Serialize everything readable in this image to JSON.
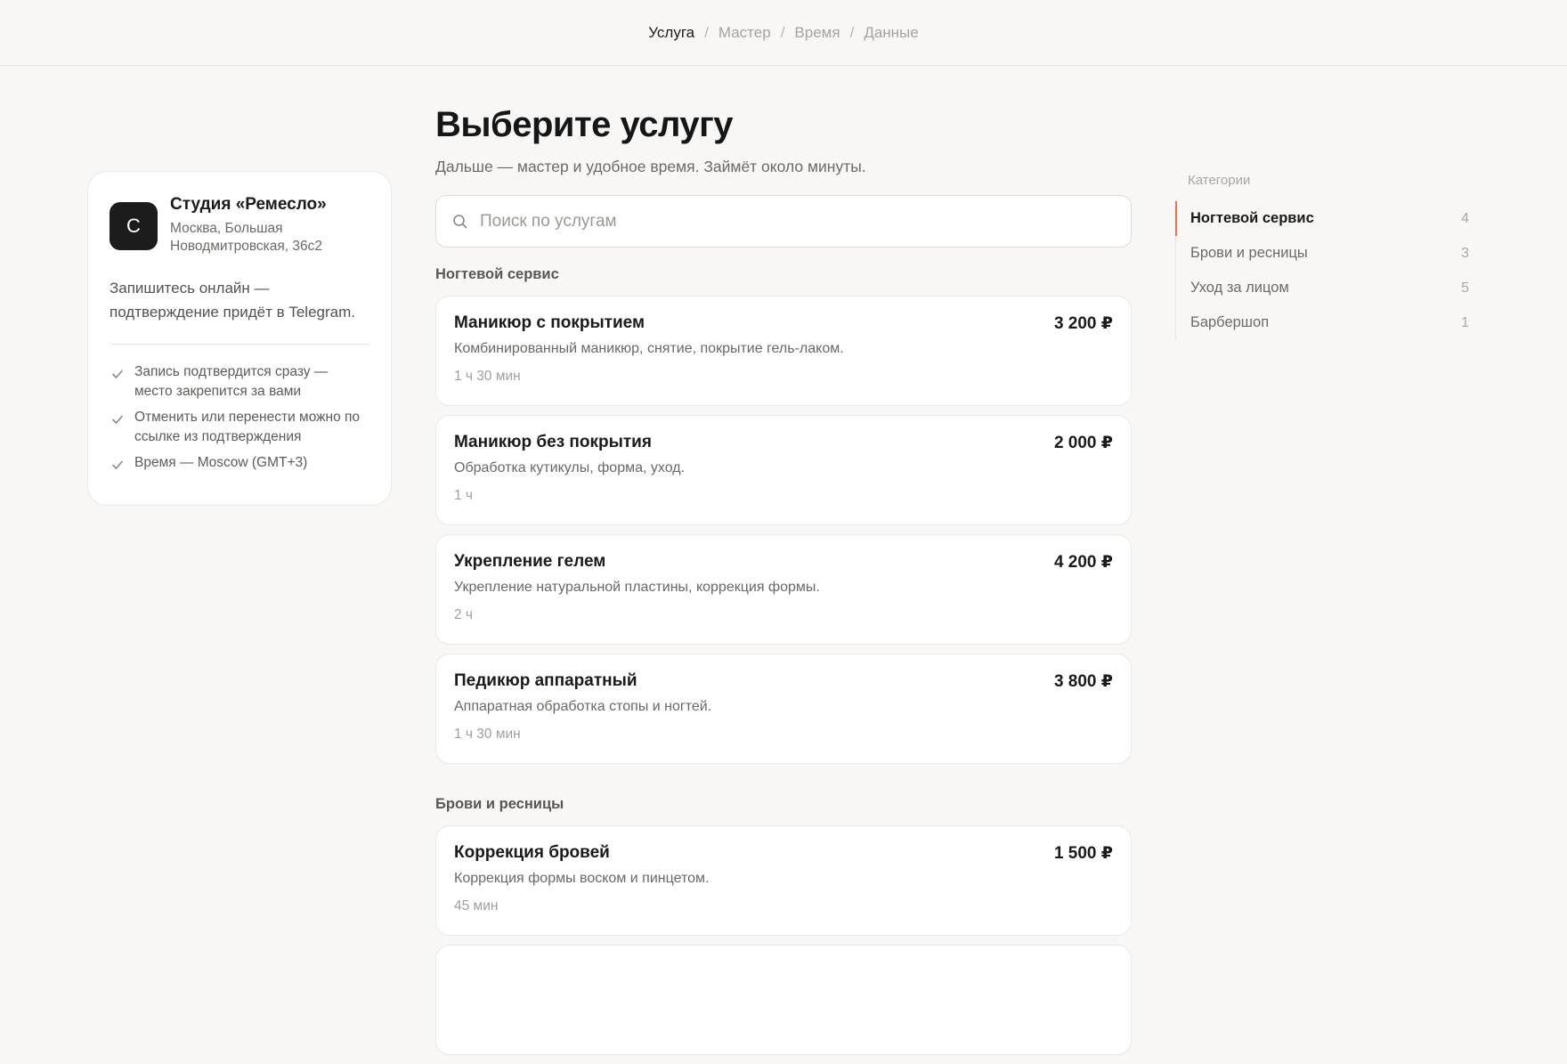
{
  "breadcrumb": [
    {
      "label": "Услуга",
      "active": true
    },
    {
      "label": "Мастер",
      "active": false
    },
    {
      "label": "Время",
      "active": false
    },
    {
      "label": "Данные",
      "active": false
    }
  ],
  "breadcrumb_separator": "/",
  "studio": {
    "avatar_letter": "С",
    "name": "Студия «Ремесло»",
    "address": "Москва, Большая Новодмитровская, 36с2",
    "description": "Запишитесь онлайн — подтверждение придёт в Telegram.",
    "checks": [
      "Запись подтвердится сразу — место закрепится за вами",
      "Отменить или перенести можно по ссылке из подтверждения",
      "Время — Moscow (GMT+3)"
    ]
  },
  "main": {
    "title": "Выберите услугу",
    "subtitle": "Дальше — мастер и удобное время. Займёт около минуты.",
    "search_placeholder": "Поиск по услугам",
    "search_value": "",
    "sections": [
      {
        "title": "Ногтевой сервис",
        "services": [
          {
            "name": "Маникюр с покрытием",
            "price": "3 200 ₽",
            "description": "Комбинированный маникюр, снятие, покрытие гель-лаком.",
            "duration": "1 ч 30 мин"
          },
          {
            "name": "Маникюр без покрытия",
            "price": "2 000 ₽",
            "description": "Обработка кутикулы, форма, уход.",
            "duration": "1 ч"
          },
          {
            "name": "Укрепление гелем",
            "price": "4 200 ₽",
            "description": "Укрепление натуральной пластины, коррекция формы.",
            "duration": "2 ч"
          },
          {
            "name": "Педикюр аппаратный",
            "price": "3 800 ₽",
            "description": "Аппаратная обработка стопы и ногтей.",
            "duration": "1 ч 30 мин"
          }
        ]
      },
      {
        "title": "Брови и ресницы",
        "services": [
          {
            "name": "Коррекция бровей",
            "price": "1 500 ₽",
            "description": "Коррекция формы воском и пинцетом.",
            "duration": "45 мин"
          },
          {
            "name": "",
            "price": "",
            "description": "",
            "duration": ""
          }
        ]
      }
    ]
  },
  "categories": {
    "heading": "Категории",
    "items": [
      {
        "label": "Ногтевой сервис",
        "count": "4",
        "active": true
      },
      {
        "label": "Брови и ресницы",
        "count": "3",
        "active": false
      },
      {
        "label": "Уход за лицом",
        "count": "5",
        "active": false
      },
      {
        "label": "Барбершоп",
        "count": "1",
        "active": false
      }
    ]
  },
  "colors": {
    "accent": "#e8704a",
    "avatar_bg": "#1c1c1c",
    "page_bg": "#f8f7f5"
  },
  "icons": {
    "search": "search-icon",
    "check": "check-icon"
  }
}
